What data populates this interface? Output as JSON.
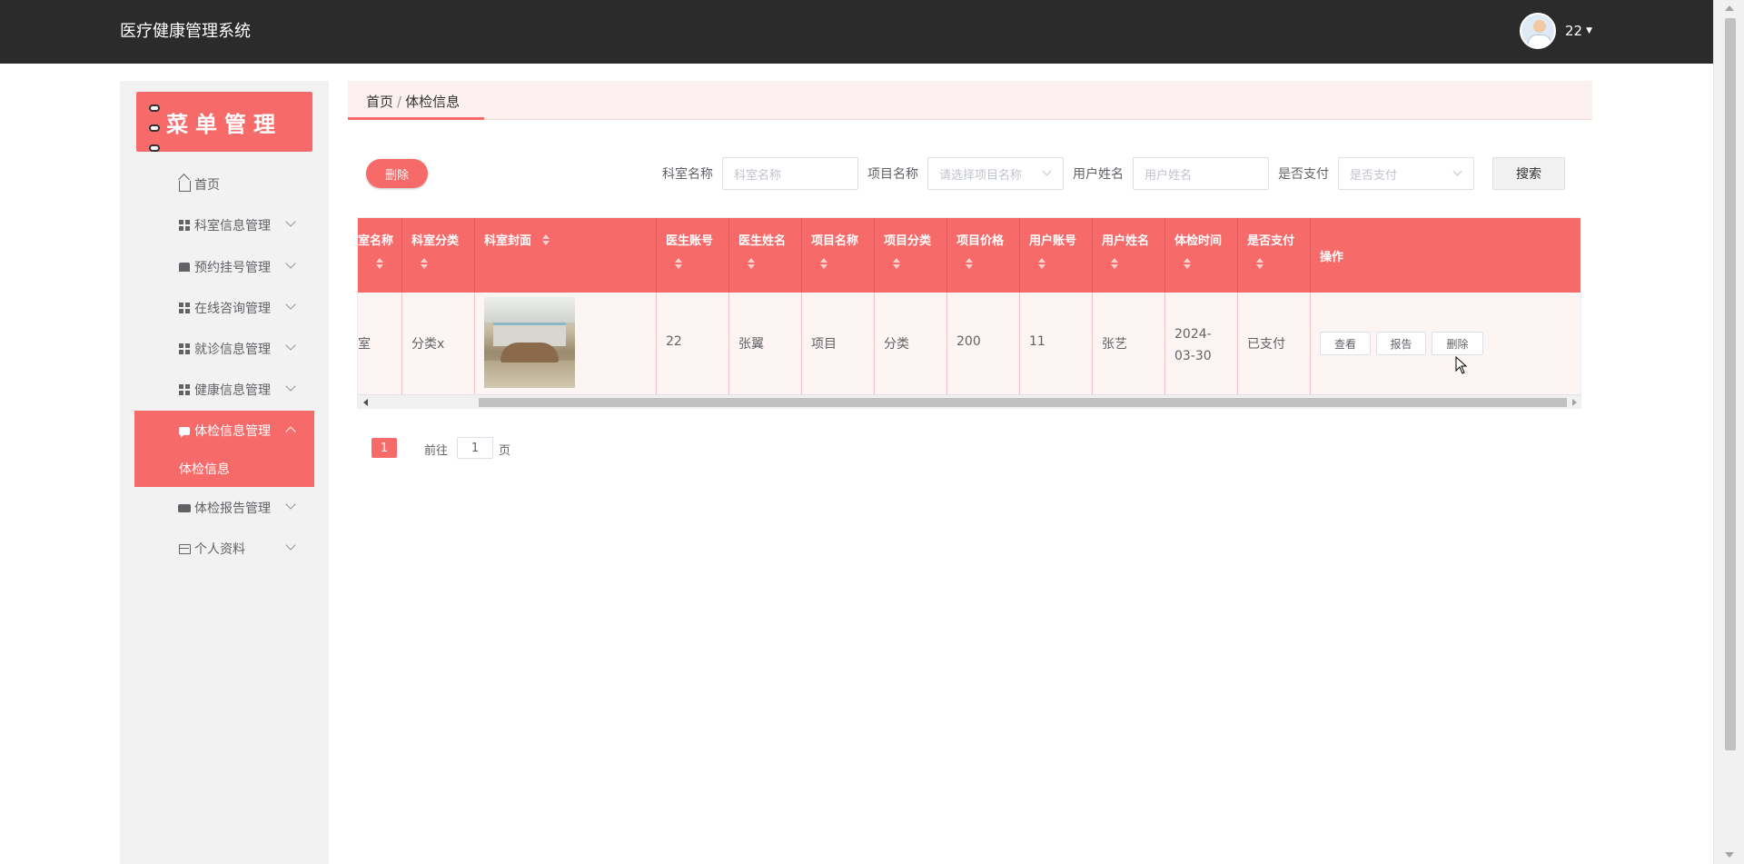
{
  "app": {
    "title": "医疗健康管理系统"
  },
  "user": {
    "name": "22"
  },
  "sidebar": {
    "banner": "菜单管理",
    "items": [
      {
        "label": "首页",
        "icon": "home-icon"
      },
      {
        "label": "科室信息管理",
        "icon": "grid-icon"
      },
      {
        "label": "预约挂号管理",
        "icon": "register-icon"
      },
      {
        "label": "在线咨询管理",
        "icon": "grid-icon"
      },
      {
        "label": "就诊信息管理",
        "icon": "grid-icon"
      },
      {
        "label": "健康信息管理",
        "icon": "grid-icon"
      },
      {
        "label": "体检信息管理",
        "icon": "chat-icon"
      },
      {
        "label": "体检报告管理",
        "icon": "ticket-icon"
      },
      {
        "label": "个人资料",
        "icon": "card-icon"
      }
    ],
    "sub_items": [
      {
        "label": "体检信息"
      }
    ]
  },
  "breadcrumb": {
    "home": "首页",
    "separator": "/",
    "current": "体检信息"
  },
  "toolbar": {
    "delete_label": "删除",
    "filters": [
      {
        "label": "科室名称",
        "placeholder": "科室名称"
      },
      {
        "label": "项目名称",
        "placeholder": "请选择项目名称"
      },
      {
        "label": "用户姓名",
        "placeholder": "用户姓名"
      },
      {
        "label": "是否支付",
        "placeholder": "是否支付"
      }
    ],
    "search_label": "搜索"
  },
  "table": {
    "headers": [
      "室名称",
      "科室分类",
      "科室封面",
      "医生账号",
      "医生姓名",
      "项目名称",
      "项目分类",
      "项目价格",
      "用户账号",
      "用户姓名",
      "体检时间",
      "是否支付",
      "操作"
    ],
    "row": [
      "室",
      "分类x",
      "",
      "22",
      "张翼",
      "项目",
      "分类",
      "200",
      "11",
      "张艺",
      "2024-03-30",
      "已支付"
    ],
    "actions": [
      "查看",
      "报告",
      "删除"
    ]
  },
  "pagination": {
    "current": "1",
    "goto_prefix": "前往",
    "goto_value": "1",
    "goto_suffix": "页"
  },
  "colors": {
    "accent": "#f76a6a",
    "topbar": "#2b2b2b",
    "sidebar_bg": "#f2f2f2",
    "row_bg": "#fdf4f4"
  }
}
